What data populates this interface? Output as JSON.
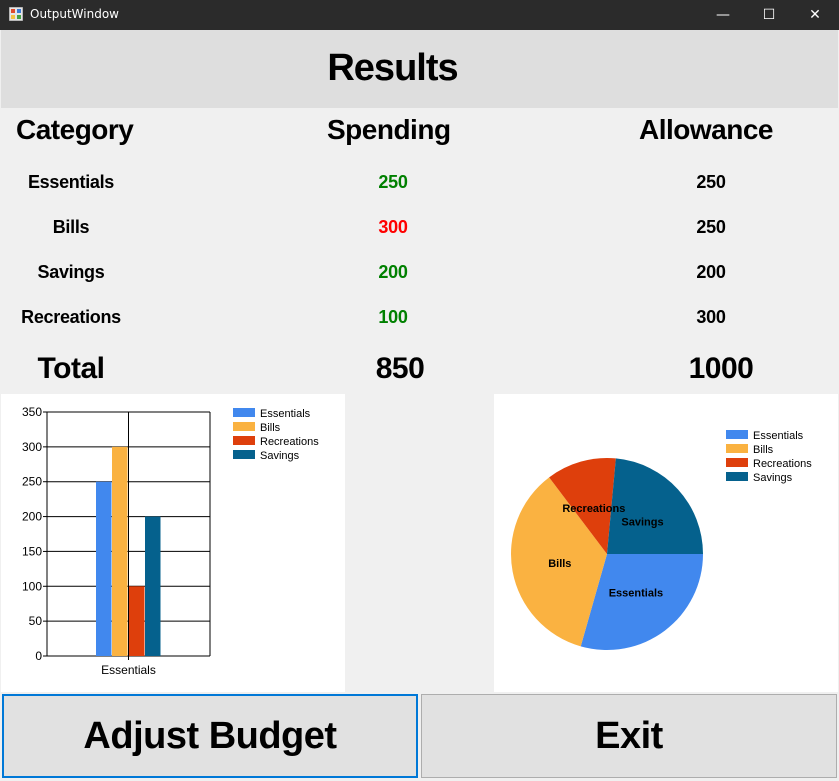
{
  "window": {
    "title": "OutputWindow",
    "minimize": "—",
    "maximize": "☐",
    "close": "✕",
    "icon": "app-icon"
  },
  "results": {
    "title": "Results"
  },
  "headers": {
    "category": "Category",
    "spending": "Spending",
    "allowance": "Allowance"
  },
  "rows": [
    {
      "category": "Essentials",
      "spending": "250",
      "allowance": "250",
      "status": "ok"
    },
    {
      "category": "Bills",
      "spending": "300",
      "allowance": "250",
      "status": "over"
    },
    {
      "category": "Savings",
      "spending": "200",
      "allowance": "200",
      "status": "ok"
    },
    {
      "category": "Recreations",
      "spending": "100",
      "allowance": "300",
      "status": "ok"
    }
  ],
  "totals": {
    "label": "Total",
    "spending": "850",
    "allowance": "1000"
  },
  "colors": {
    "ok": "#008000",
    "over": "#ff0000",
    "essentials": "#4188ee",
    "bills": "#fab241",
    "recreations": "#de3f0c",
    "savings": "#05618d"
  },
  "buttons": {
    "adjust": "Adjust Budget",
    "exit": "Exit"
  },
  "chart_data": [
    {
      "type": "bar",
      "categories": [
        "Essentials"
      ],
      "series": [
        {
          "name": "Essentials",
          "values": [
            250
          ],
          "color": "#4188ee"
        },
        {
          "name": "Bills",
          "values": [
            300
          ],
          "color": "#fab241"
        },
        {
          "name": "Recreations",
          "values": [
            100
          ],
          "color": "#de3f0c"
        },
        {
          "name": "Savings",
          "values": [
            200
          ],
          "color": "#05618d"
        }
      ],
      "ylim": [
        0,
        350
      ],
      "yticks": [
        0,
        50,
        100,
        150,
        200,
        250,
        300,
        350
      ],
      "grid": true,
      "legend": "top-right"
    },
    {
      "type": "pie",
      "slices": [
        {
          "name": "Essentials",
          "value": 250,
          "color": "#4188ee"
        },
        {
          "name": "Bills",
          "value": 300,
          "color": "#fab241"
        },
        {
          "name": "Recreations",
          "value": 100,
          "color": "#de3f0c"
        },
        {
          "name": "Savings",
          "value": 200,
          "color": "#05618d"
        }
      ],
      "legend": "top-right"
    }
  ]
}
